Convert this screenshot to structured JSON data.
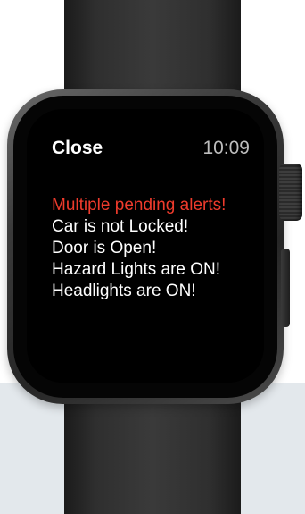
{
  "watch": {
    "close_label": "Close",
    "time": "10:09"
  },
  "alerts": {
    "title": "Multiple pending alerts!",
    "items": [
      "Car is not Locked!",
      "Door is Open!",
      "Hazard Lights are ON!",
      "Headlights are ON!"
    ]
  },
  "colors": {
    "alert_title": "#ee3b2c",
    "text": "#ffffff",
    "time": "#bdbdbd",
    "screen": "#000000"
  }
}
